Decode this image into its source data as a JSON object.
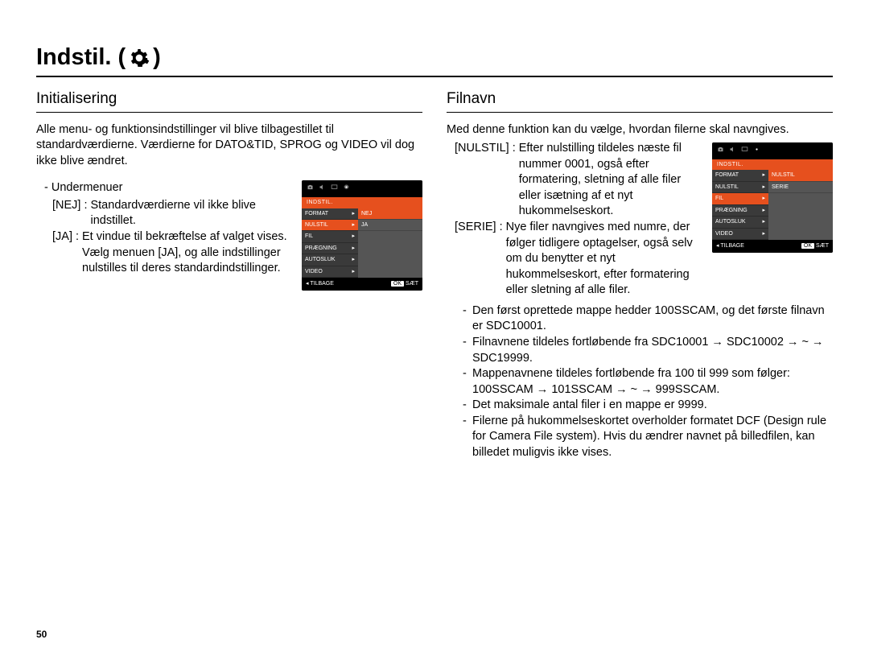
{
  "page_title_prefix": "Indstil. (",
  "page_title_suffix": ")",
  "page_number": "50",
  "left": {
    "heading": "Initialisering",
    "intro": "Alle menu- og funktionsindstillinger vil blive tilbagestillet til standardværdierne. Værdierne for DATO&TID, SPROG og VIDEO vil dog ikke blive ændret.",
    "sub_head": "- Undermenuer",
    "defs": [
      {
        "key": "[NEJ]",
        "val": "Standardværdierne vil ikke blive indstillet."
      },
      {
        "key": "[JA]",
        "val": "Et vindue til bekræftelse af valget vises. Vælg menuen [JA], og alle indstillinger nulstilles til deres standardindstillinger."
      }
    ],
    "lcd": {
      "header": "INDSTIL.",
      "menu": [
        "FORMAT",
        "NULSTIL",
        "FIL",
        "PRÆGNING",
        "AUTOSLUK",
        "VIDEO"
      ],
      "menu_hi_index": 1,
      "opts": [
        "NEJ",
        "JA"
      ],
      "opts_hi_index": 0,
      "back": "TILBAGE",
      "ok": "OK",
      "set": "SÆT"
    }
  },
  "right": {
    "heading": "Filnavn",
    "intro": "Med denne funktion kan du vælge, hvordan filerne skal navngives.",
    "defs": [
      {
        "key": "[NULSTIL]",
        "val": "Efter nulstilling tildeles næste fil nummer 0001, også efter formatering, sletning af alle filer eller isætning af et nyt hukommelseskort."
      },
      {
        "key": "[SERIE]",
        "val": "Nye filer navngives med numre, der følger tidligere optagelser, også selv om du benytter et nyt hukommelseskort, efter formatering eller sletning af alle filer."
      }
    ],
    "bullets": [
      "Den først oprettede mappe hedder 100SSCAM, og det første filnavn er SDC10001.",
      "Filnavnene tildeles fortløbende fra SDC10001 → SDC10002 → ~ → SDC19999.",
      "Mappenavnene tildeles fortløbende fra 100 til 999 som følger: 100SSCAM → 101SSCAM → ~ → 999SSCAM.",
      "Det maksimale antal filer i en mappe er 9999.",
      "Filerne på hukommelseskortet overholder formatet DCF (Design rule for Camera File system). Hvis du ændrer navnet på billedfilen, kan billedet muligvis ikke vises."
    ],
    "lcd": {
      "header": "INDSTIL.",
      "menu": [
        "FORMAT",
        "NULSTIL",
        "FIL",
        "PRÆGNING",
        "AUTOSLUK",
        "VIDEO"
      ],
      "menu_hi_index": 2,
      "opts": [
        "NULSTIL",
        "SERIE"
      ],
      "opts_hi_index": 0,
      "back": "TILBAGE",
      "ok": "OK",
      "set": "SÆT"
    }
  }
}
